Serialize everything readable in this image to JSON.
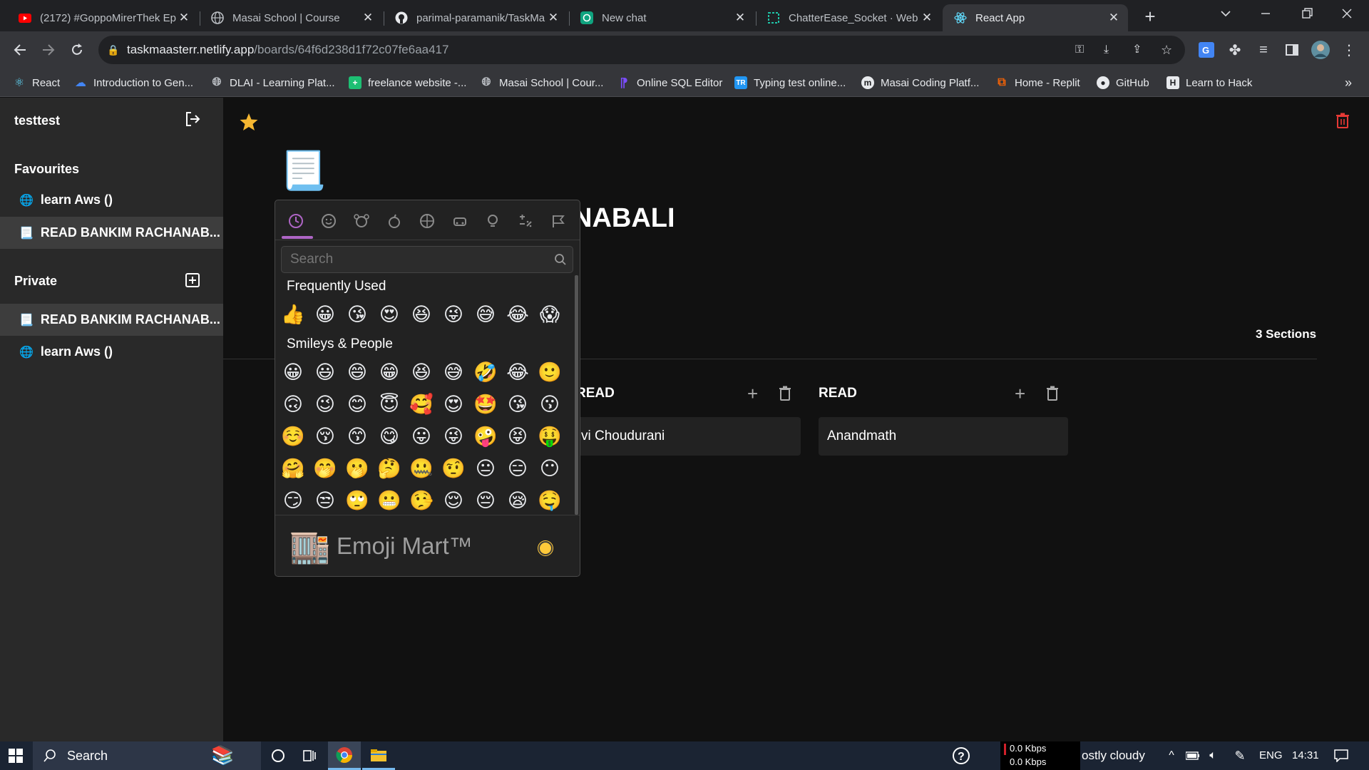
{
  "browser": {
    "tabs": [
      {
        "title": "(2172) #GoppoMirerThek Ep",
        "icon": "youtube-icon",
        "color": "#ff0000"
      },
      {
        "title": "Masai School | Course",
        "icon": "globe-icon"
      },
      {
        "title": "parimal-paramanik/TaskMa",
        "icon": "github-icon"
      },
      {
        "title": "New chat",
        "icon": "chatgpt-icon",
        "color": "#10a37f"
      },
      {
        "title": "ChatterEase_Socket · Web S",
        "icon": "codesandbox-icon",
        "color": "#1fc5a8"
      },
      {
        "title": "React App",
        "icon": "react-icon",
        "color": "#61dafb"
      }
    ],
    "url_host": "taskmaasterr.netlify.app",
    "url_path": "/boards/64f6d238d1f72c07fe6aa417",
    "bookmarks": [
      {
        "label": "React",
        "icon": "react-icon",
        "color": "#61dafb"
      },
      {
        "label": "Introduction to Gen...",
        "icon": "google-cloud-icon",
        "color": "#4285f4"
      },
      {
        "label": "DLAI - Learning Plat...",
        "icon": "globe-icon"
      },
      {
        "label": "freelance website -...",
        "icon": "plus-square-icon",
        "color": "#1dbf73"
      },
      {
        "label": "Masai School | Cour...",
        "icon": "globe-icon"
      },
      {
        "label": "Online SQL Editor",
        "icon": "sql-editor-icon",
        "color": "#7c4dff"
      },
      {
        "label": "Typing test online...",
        "icon": "typing-test-icon",
        "color": "#2196f3"
      },
      {
        "label": "Masai Coding Platf...",
        "icon": "masai-icon"
      },
      {
        "label": "Home - Replit",
        "icon": "replit-icon",
        "color": "#f26207"
      },
      {
        "label": "GitHub",
        "icon": "github-icon"
      },
      {
        "label": "Learn to Hack",
        "icon": "hackerone-icon"
      }
    ],
    "more_bookmarks": "»"
  },
  "sidebar": {
    "username": "testtest",
    "favourites_heading": "Favourites",
    "favourites": [
      {
        "icon": "🌐",
        "label": "learn Aws ()"
      },
      {
        "icon": "📃",
        "label": "READ BANKIM RACHANAB..."
      }
    ],
    "private_heading": "Private",
    "private": [
      {
        "icon": "📃",
        "label": "READ BANKIM RACHANAB..."
      },
      {
        "icon": "🌐",
        "label": "learn Aws ()"
      }
    ]
  },
  "board": {
    "page_icon": "📃",
    "title_visible": "NABALI",
    "sections_count": "3 Sections",
    "columns": [
      {
        "title": "READ",
        "cards": [
          "vi Choudurani"
        ]
      },
      {
        "title": "READ",
        "cards": [
          "Anandmath"
        ]
      }
    ]
  },
  "emoji_picker": {
    "search_placeholder": "Search",
    "frequently_used_label": "Frequently Used",
    "smileys_label": "Smileys & People",
    "categories": [
      "clock-icon",
      "smiley-icon",
      "animal-icon",
      "food-icon",
      "sports-icon",
      "car-icon",
      "lightbulb-icon",
      "symbols-icon",
      "flag-icon"
    ],
    "frequently_used": [
      "👍",
      "😀",
      "😘",
      "😍",
      "😆",
      "😜",
      "😅",
      "😂",
      "😱"
    ],
    "smileys": [
      [
        "😀",
        "😃",
        "😄",
        "😁",
        "😆",
        "😅",
        "🤣",
        "😂",
        "🙂"
      ],
      [
        "🙃",
        "😉",
        "😊",
        "😇",
        "🥰",
        "😍",
        "🤩",
        "😘",
        "😗"
      ],
      [
        "☺️",
        "😚",
        "😙",
        "😋",
        "😛",
        "😜",
        "🤪",
        "😝",
        "🤑"
      ],
      [
        "🤗",
        "🤭",
        "🫢",
        "🤔",
        "🤐",
        "🤨",
        "😐",
        "😑",
        "😶"
      ],
      [
        "😏",
        "😒",
        "🙄",
        "😬",
        "🤥",
        "😌",
        "😔",
        "😪",
        "🤤"
      ]
    ],
    "footer_icon": "🏬",
    "footer_label": "Emoji Mart™",
    "accent_color": "#ae65c5"
  },
  "taskbar": {
    "search_label": "Search",
    "net_up": "0.0 Kbps",
    "net_down": "0.0 Kbps",
    "weather": "ostly cloudy",
    "language": "ENG",
    "time": "14:31"
  }
}
